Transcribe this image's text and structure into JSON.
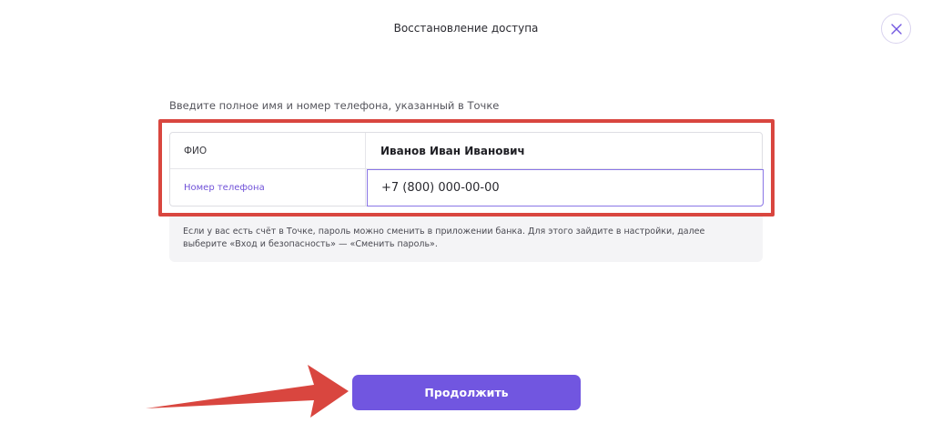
{
  "header": {
    "title": "Восстановление доступа",
    "close_icon": "close-icon"
  },
  "form": {
    "hint": "Введите полное имя и номер телефона, указанный в Точке",
    "fio_label": "ФИО",
    "fio_value": "Иванов Иван Иванович",
    "phone_label": "Номер телефона",
    "phone_value": "+7 (800) 000-00-00"
  },
  "info": {
    "text": "Если у вас есть счёт в Точке, пароль можно сменить в приложении банка. Для этого зайдите в настройки, далее выберите «Вход и безопасность» — «Сменить пароль»."
  },
  "actions": {
    "continue_label": "Продолжить"
  },
  "colors": {
    "accent": "#7156e0",
    "annotation_red": "#d9463f"
  }
}
